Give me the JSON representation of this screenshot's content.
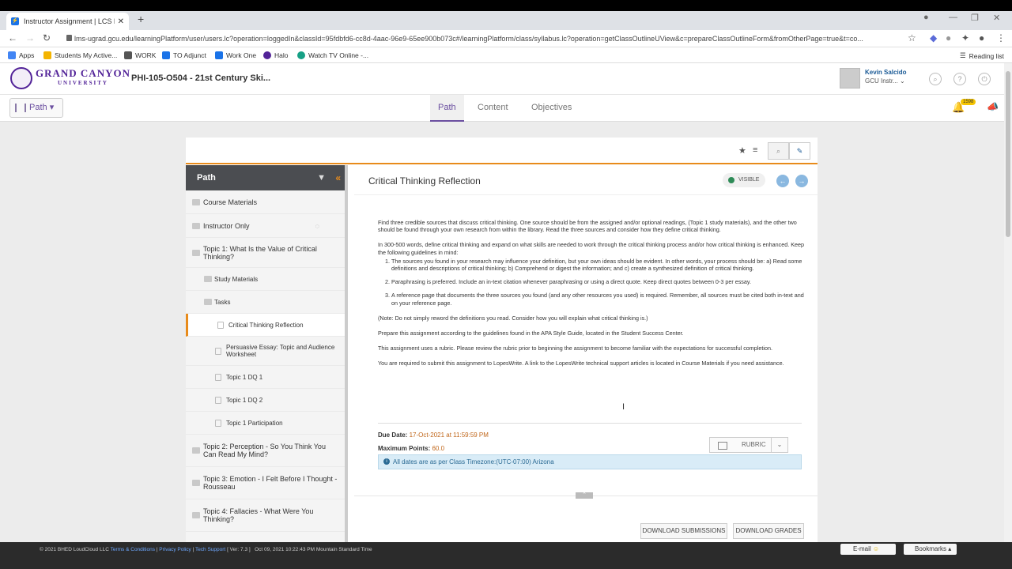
{
  "browser": {
    "tab_title": "Instructor Assignment | LCS Lea",
    "url": "lms-ugrad.gcu.edu/learningPlatform/user/users.lc?operation=loggedIn&classId=95fdbfd6-cc8d-4aac-96e9-65ee900b073c#/learningPlatform/class/syllabus.lc?operation=getClassOutlineUView&c=prepareClassOutlineForm&fromOtherPage=true&t=co...",
    "bookmarks": [
      "Apps",
      "Students My Active...",
      "WORK",
      "TO Adjunct",
      "Work One",
      "Halo",
      "Watch TV Online -..."
    ],
    "reading_list": "Reading list"
  },
  "header": {
    "logo_line1": "GRAND CANYON",
    "logo_line2": "UNIVERSITY",
    "course": "PHI-105-O504 - 21st Century Ski...",
    "user_name": "Kevin Salcido",
    "user_role": "GCU Instr..."
  },
  "subnav": {
    "path_button": "Path",
    "tabs": [
      "Path",
      "Content",
      "Objectives"
    ],
    "notification_count": "1598"
  },
  "sidebar": {
    "title": "Path",
    "items": [
      {
        "label": "Course Materials"
      },
      {
        "label": "Instructor Only"
      },
      {
        "label": "Topic 1: What Is the Value of Critical Thinking?"
      },
      {
        "label": "Study Materials"
      },
      {
        "label": "Tasks"
      },
      {
        "label": "Critical Thinking Reflection"
      },
      {
        "label": "Persuasive Essay: Topic and Audience Worksheet"
      },
      {
        "label": "Topic 1 DQ 1"
      },
      {
        "label": "Topic 1 DQ 2"
      },
      {
        "label": "Topic 1 Participation"
      },
      {
        "label": "Topic 2: Perception - So You Think You Can Read My Mind?"
      },
      {
        "label": "Topic 3: Emotion - I Felt Before I Thought - Rousseau"
      },
      {
        "label": "Topic 4: Fallacies - What Were You Thinking?"
      }
    ]
  },
  "assignment": {
    "title": "Critical Thinking Reflection",
    "visibility": "VISIBLE",
    "p1": "Find three credible sources that discuss critical thinking. One source should be from the assigned and/or optional readings, (Topic 1 study materials), and the other two should be found through your own research from within the library. Read the three sources and consider how they define critical thinking.",
    "p2": "In 300-500 words, define critical thinking and expand on what skills are needed to work through the critical thinking process and/or how critical thinking is enhanced. Keep the following guidelines in mind:",
    "li1": "The sources you found in your research may influence your definition, but your own ideas should be evident. In other words, your process should be: a) Read some definitions and descriptions of critical thinking; b) Comprehend or digest the information; and c) create a synthesized definition of critical thinking.",
    "li2": "Paraphrasing is preferred. Include an in-text citation whenever paraphrasing or using a direct quote. Keep direct quotes between 0-3 per essay.",
    "li3": "A reference page that documents the three sources you found (and any other resources you used) is required. Remember, all sources must be cited both in-text and on your reference page.",
    "p3": "(Note: Do not simply reword the definitions you read. Consider how you will explain what critical thinking is.)",
    "p4": "Prepare this assignment according to the guidelines found in the APA Style Guide, located in the Student Success Center.",
    "p5": "This assignment uses a rubric. Please review the rubric prior to beginning the assignment to become familiar with the expectations for successful completion.",
    "p6": "You are required to submit this assignment to LopesWrite. A link to the LopesWrite technical support articles is located in Course Materials if you need assistance.",
    "due_label": "Due Date:",
    "due_value": "17-Oct-2021 at 11:59:59 PM",
    "points_label": "Maximum Points:",
    "points_value": "60.0",
    "rubric_label": "RUBRIC",
    "timezone_note": "All dates are as per Class Timezone:(UTC-07:00) Arizona",
    "download_submissions": "DOWNLOAD SUBMISSIONS",
    "download_grades": "DOWNLOAD GRADES"
  },
  "footer": {
    "copyright": "© 2021 BHED LoudCloud LLC",
    "terms": "Terms & Conditions",
    "privacy": "Privacy Policy",
    "support": "Tech Support",
    "version": "[ Ver: 7.3 ]",
    "datetime": "Oct 09, 2021  10:22:43 PM Mountain Standard Time",
    "email": "E-mail",
    "bookmarks": "Bookmarks"
  },
  "colors": {
    "accent": "#e88b1b",
    "brand": "#522398",
    "link": "#1a5a96"
  }
}
